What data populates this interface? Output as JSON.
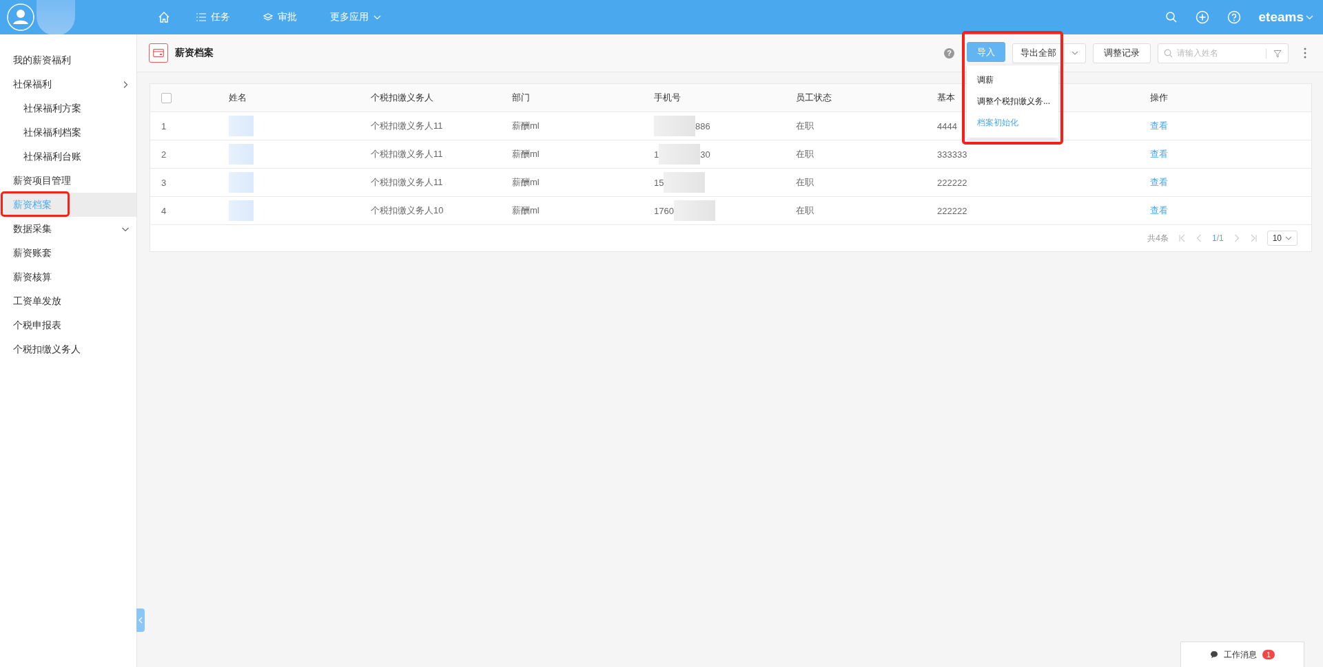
{
  "top_bar": {
    "nav": [
      {
        "kind": "home"
      },
      {
        "kind": "list",
        "label": "任务"
      },
      {
        "kind": "layers",
        "label": "审批"
      },
      {
        "kind": "more",
        "label": "更多应用"
      }
    ],
    "brand": "eteams"
  },
  "sidebar": {
    "items": [
      {
        "label": "我的薪资福利",
        "selected": false,
        "highlighted": false
      },
      {
        "label": "社保福利",
        "selected": false,
        "highlighted": false,
        "expanded": true,
        "children": [
          {
            "label": "社保福利方案",
            "selected": false
          },
          {
            "label": "社保福利档案",
            "selected": false
          },
          {
            "label": "社保福利台账",
            "selected": false
          }
        ]
      },
      {
        "label": "薪资项目管理",
        "selected": false,
        "highlighted": false
      },
      {
        "label": "薪资档案",
        "selected": true,
        "highlighted": true
      },
      {
        "label": "数据采集",
        "selected": false,
        "highlighted": false,
        "expanded": false
      },
      {
        "label": "薪资账套",
        "selected": false,
        "highlighted": false
      },
      {
        "label": "薪资核算",
        "selected": false,
        "highlighted": false
      },
      {
        "label": "工资单发放",
        "selected": false,
        "highlighted": false
      },
      {
        "label": "个税申报表",
        "selected": false,
        "highlighted": false
      },
      {
        "label": "个税扣缴义务人",
        "selected": false,
        "highlighted": false
      }
    ]
  },
  "page": {
    "title": "薪资档案",
    "help_mark": "?",
    "import_button": "导入",
    "export_button": "导出全部",
    "record_button": "调整记录",
    "search": {
      "placeholder": "请输入姓名"
    },
    "highlighted": true,
    "import_menu": [
      {
        "label": "调薪",
        "kind": "normal"
      },
      {
        "label": "调整个税扣缴义务...",
        "kind": "normal"
      },
      {
        "label": "档案初始化",
        "kind": "link"
      }
    ]
  },
  "table": {
    "select_all": {
      "checked": false
    },
    "columns": [
      "姓名",
      "个税扣缴义务人",
      "部门",
      "手机号",
      "员工状态",
      "基本",
      "操作"
    ],
    "rows": [
      {
        "index": "1",
        "withholder": "个税扣缴义务人11",
        "department": "薪酬ml",
        "phone_start": "",
        "phone_end": "886",
        "status": "在职",
        "salary": "4444",
        "action": "查看"
      },
      {
        "index": "2",
        "withholder": "个税扣缴义务人11",
        "department": "薪酬ml",
        "phone_start": "1",
        "phone_end": "30",
        "status": "在职",
        "salary": "333333",
        "action": "查看"
      },
      {
        "index": "3",
        "withholder": "个税扣缴义务人11",
        "department": "薪酬ml",
        "phone_start": "15",
        "phone_end": "",
        "status": "在职",
        "salary": "222222",
        "action": "查看"
      },
      {
        "index": "4",
        "withholder": "个税扣缴义务人10",
        "department": "薪酬ml",
        "phone_start": "1760",
        "phone_end": "",
        "status": "在职",
        "salary": "222222",
        "action": "查看"
      }
    ]
  },
  "pagination": {
    "total": "共4条",
    "current": "1",
    "pages": "/1",
    "page_size": "10"
  },
  "message_bar": {
    "label": "工作消息",
    "count": "1"
  }
}
